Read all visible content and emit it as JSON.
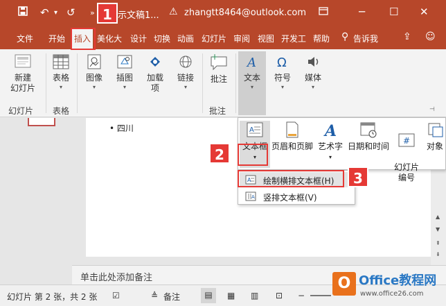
{
  "titlebar": {
    "title": "示文稿1...",
    "account": "zhangtt8464@outlook.com",
    "qa_more": "»"
  },
  "tabs": [
    "文件",
    "开始",
    "插入",
    "美化大",
    "设计",
    "切换",
    "动画",
    "幻灯片",
    "审阅",
    "视图",
    "开发工",
    "帮助",
    "告诉我"
  ],
  "ribbon": {
    "new_slide": "新建\n幻灯片",
    "table": "表格",
    "image": "图像",
    "illustration": "插图",
    "addin": "加载\n项",
    "link": "链接",
    "comment": "批注",
    "text": "文本",
    "symbol": "符号",
    "media": "媒体",
    "groups": {
      "slides": "幻灯片",
      "tables": "表格",
      "comments": "批注"
    }
  },
  "gallery": {
    "items": [
      "文本框",
      "页眉和页脚",
      "艺术字",
      "日期和时间",
      "幻灯片\n编号",
      "对象"
    ]
  },
  "dropdown": {
    "items": [
      "绘制横排文本框(H)",
      "竖排文本框(V)"
    ]
  },
  "slide": {
    "bullet": "• 四川"
  },
  "notes_placeholder": "单击此处添加备注",
  "statusbar": {
    "slide_info": "幻灯片 第 2 张，共 2 张",
    "notes": "备注"
  },
  "badges": [
    "1",
    "2",
    "3"
  ],
  "watermark": {
    "brand": "Office教程网",
    "url": "www.office26.com",
    "logo": "O"
  },
  "colors": {
    "accent": "#b7472a",
    "highlight": "#e53935"
  }
}
